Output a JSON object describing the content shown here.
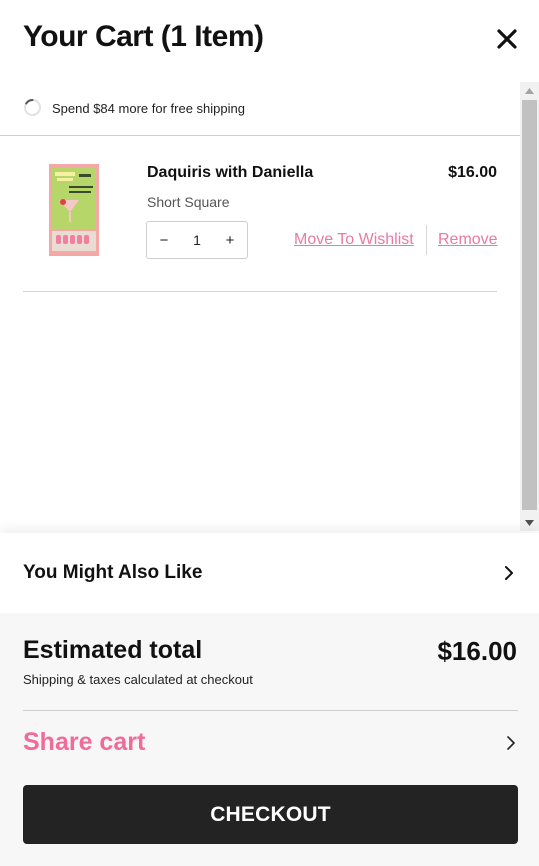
{
  "header": {
    "title": "Your Cart (1 Item)",
    "close_icon": "close-icon"
  },
  "shipping": {
    "message": "Spend $84 more for free shipping",
    "progress": 0.16,
    "icon": "progress-spinner-icon"
  },
  "cart": {
    "items": [
      {
        "name": "Daquiris with Daniella",
        "variant": "Short Square",
        "price": "$16.00",
        "quantity": "1",
        "decrease_label": "−",
        "increase_label": "+",
        "wishlist_label": "Move To Wishlist",
        "remove_label": "Remove"
      }
    ]
  },
  "recommendations": {
    "title": "You Might Also Like",
    "icon": "chevron-right-icon"
  },
  "summary": {
    "label": "Estimated total",
    "total": "$16.00",
    "note": "Shipping & taxes calculated at checkout",
    "share_label": "Share cart",
    "checkout_label": "CHECKOUT"
  },
  "colors": {
    "accent_pink": "#f06b98",
    "link_pink": "#e87aa4",
    "checkout_bg": "#232323",
    "footer_bg": "#f7f7f7"
  }
}
